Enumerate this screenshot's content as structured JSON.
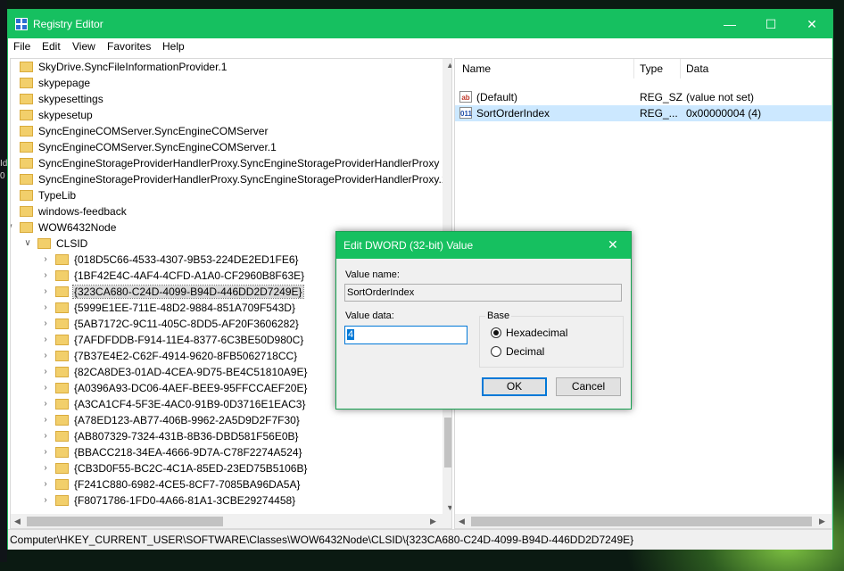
{
  "window": {
    "title": "Registry Editor",
    "minimize": "—",
    "maximize": "☐",
    "close": "✕"
  },
  "menu": [
    "File",
    "Edit",
    "View",
    "Favorites",
    "Help"
  ],
  "tree": {
    "top_items": [
      "SkyDrive.SyncFileInformationProvider.1",
      "skypepage",
      "skypesettings",
      "skypesetup",
      "SyncEngineCOMServer.SyncEngineCOMServer",
      "SyncEngineCOMServer.SyncEngineCOMServer.1",
      "SyncEngineStorageProviderHandlerProxy.SyncEngineStorageProviderHandlerProxy",
      "SyncEngineStorageProviderHandlerProxy.SyncEngineStorageProviderHandlerProxy.1",
      "TypeLib",
      "windows-feedback",
      "WOW6432Node"
    ],
    "clsid_label": "CLSID",
    "clsid_children": [
      "{018D5C66-4533-4307-9B53-224DE2ED1FE6}",
      "{1BF42E4C-4AF4-4CFD-A1A0-CF2960B8F63E}",
      "{323CA680-C24D-4099-B94D-446DD2D7249E}",
      "{5999E1EE-711E-48D2-9884-851A709F543D}",
      "{5AB7172C-9C11-405C-8DD5-AF20F3606282}",
      "{7AFDFDDB-F914-11E4-8377-6C3BE50D980C}",
      "{7B37E4E2-C62F-4914-9620-8FB5062718CC}",
      "{82CA8DE3-01AD-4CEA-9D75-BE4C51810A9E}",
      "{A0396A93-DC06-4AEF-BEE9-95FFCCAEF20E}",
      "{A3CA1CF4-5F3E-4AC0-91B9-0D3716E1EAC3}",
      "{A78ED123-AB77-406B-9962-2A5D9D2F7F30}",
      "{AB807329-7324-431B-8B36-DBD581F56E0B}",
      "{BBACC218-34EA-4666-9D7A-C78F2274A524}",
      "{CB3D0F55-BC2C-4C1A-85ED-23ED75B5106B}",
      "{F241C880-6982-4CE5-8CF7-7085BA96DA5A}",
      "{F8071786-1FD0-4A66-81A1-3CBE29274458}"
    ],
    "selected_index": 2
  },
  "list": {
    "headers": {
      "name": "Name",
      "type": "Type",
      "data": "Data"
    },
    "rows": [
      {
        "icon": "ab",
        "name": "(Default)",
        "type": "REG_SZ",
        "data": "(value not set)"
      },
      {
        "icon": "011",
        "name": "SortOrderIndex",
        "type": "REG_...",
        "data": "0x00000004 (4)"
      }
    ]
  },
  "status": "Computer\\HKEY_CURRENT_USER\\SOFTWARE\\Classes\\WOW6432Node\\CLSID\\{323CA680-C24D-4099-B94D-446DD2D7249E}",
  "dialog": {
    "title": "Edit DWORD (32-bit) Value",
    "close": "✕",
    "value_name_label": "Value name:",
    "value_name": "SortOrderIndex",
    "value_data_label": "Value data:",
    "value_data": "4",
    "base_label": "Base",
    "hex_label": "Hexadecimal",
    "dec_label": "Decimal",
    "ok": "OK",
    "cancel": "Cancel"
  },
  "desktop": {
    "left_text_1": "Id",
    "left_text_2": "0"
  }
}
